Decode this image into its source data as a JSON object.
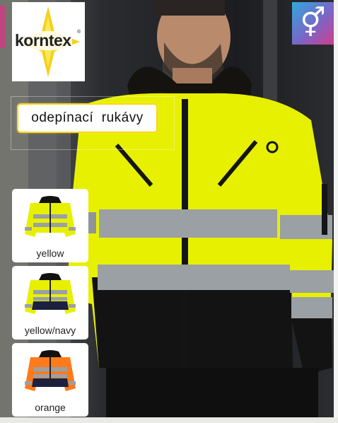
{
  "brand": {
    "name": "korntex",
    "registered_mark": "®"
  },
  "badge": {
    "symbol": "⚥",
    "icon": "gender-unisex-icon"
  },
  "feature_label": "odepínací  rukávy",
  "colors": {
    "hivis_yellow": "#e7f000",
    "hivis_orange": "#ff7a1a",
    "navy": "#1c2140",
    "black": "#111111",
    "reflective": "#9aa0a3"
  },
  "variants": [
    {
      "label": "yellow"
    },
    {
      "label": "yellow/navy"
    },
    {
      "label": "orange"
    }
  ]
}
